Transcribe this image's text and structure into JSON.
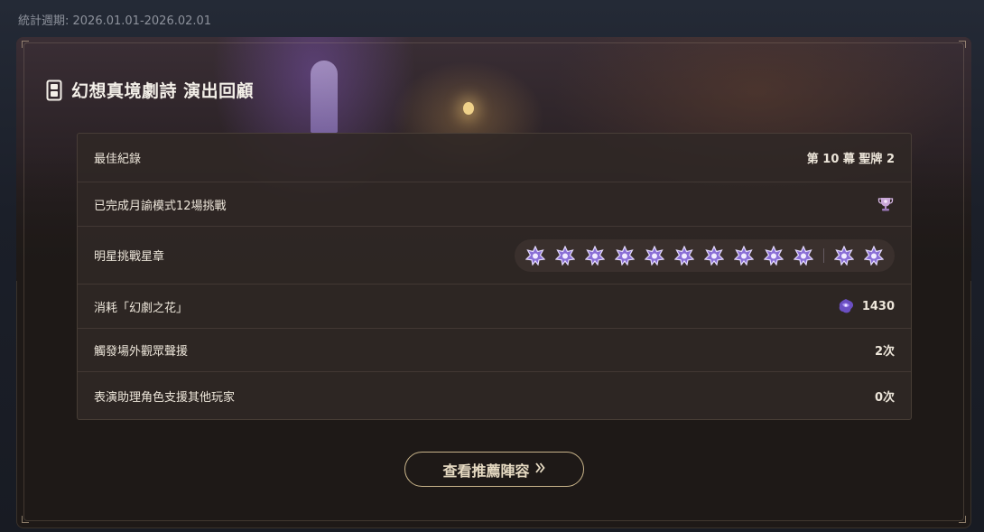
{
  "period_text": "統計週期: 2026.01.01-2026.02.01",
  "title": "幻想真境劇詩 演出回顧",
  "rows": [
    {
      "label": "最佳紀錄",
      "value": "第 10 幕  聖牌 2"
    },
    {
      "label": "已完成月諭模式12場挑戰",
      "value": "",
      "icon": "trophy-icon"
    },
    {
      "label": "明星挑戰星章",
      "value": "",
      "star_count": 12,
      "icon": "star-medal-icon"
    },
    {
      "label": "消耗「幻劇之花」",
      "value": "1430",
      "icon": "fantasia-flower-icon"
    },
    {
      "label": "觸發場外觀眾聲援",
      "value": "2次"
    },
    {
      "label": "表演助理角色支援其他玩家",
      "value": "0次"
    }
  ],
  "button": {
    "label": "查看推薦陣容",
    "icon": "double-chevron-right-icon"
  },
  "colors": {
    "accent_gold": "#c9b48a",
    "star_purple": "#8a6fd6",
    "panel_bg": "#302825"
  }
}
